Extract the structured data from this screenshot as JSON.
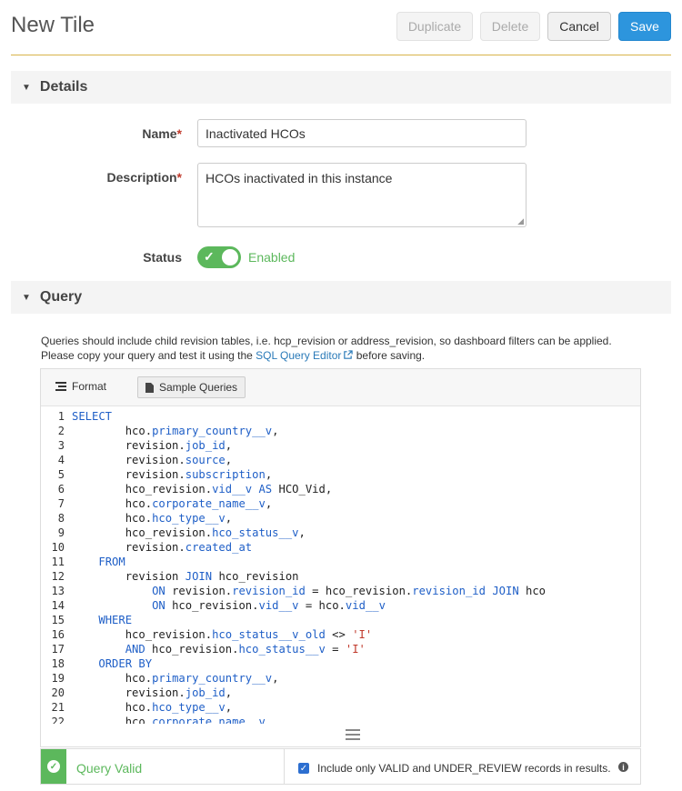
{
  "header": {
    "title": "New Tile",
    "duplicate_label": "Duplicate",
    "delete_label": "Delete",
    "cancel_label": "Cancel",
    "save_label": "Save"
  },
  "details": {
    "section_title": "Details",
    "name_label": "Name",
    "name_value": "Inactivated HCOs",
    "description_label": "Description",
    "description_value": "HCOs inactivated in this instance",
    "status_label": "Status",
    "status_value": "Enabled",
    "required_marker": "*"
  },
  "query": {
    "section_title": "Query",
    "help_line1": "Queries should include child revision tables, i.e. hcp_revision or address_revision, so dashboard filters can be applied.",
    "help_line2_pre": "Please copy your query and test it using the ",
    "help_link": "SQL Query Editor",
    "help_line2_post": " before saving.",
    "format_label": "Format",
    "sample_queries_label": "Sample Queries",
    "valid_label": "Query Valid",
    "include_label": "Include only VALID and UNDER_REVIEW records in results.",
    "include_checked": true
  },
  "icons": {
    "caret": "caret-down-icon",
    "format": "list-icon",
    "sample": "document-icon",
    "external": "external-link-icon",
    "valid": "check-circle-icon",
    "info": "info-icon",
    "resize": "resize-handle-icon"
  },
  "colors": {
    "accent": "#2d95dd",
    "valid": "#5cb85c",
    "keyword": "#1f5fc7",
    "string": "#c0392b",
    "divider": "#d8b44a"
  },
  "code_lines": [
    [
      [
        "kw",
        "SELECT"
      ]
    ],
    [
      [
        "txt",
        "        hco."
      ],
      [
        "fn",
        "primary_country__v"
      ],
      [
        "txt",
        ","
      ]
    ],
    [
      [
        "txt",
        "        revision."
      ],
      [
        "fn",
        "job_id"
      ],
      [
        "txt",
        ","
      ]
    ],
    [
      [
        "txt",
        "        revision."
      ],
      [
        "fn",
        "source"
      ],
      [
        "txt",
        ","
      ]
    ],
    [
      [
        "txt",
        "        revision."
      ],
      [
        "fn",
        "subscription"
      ],
      [
        "txt",
        ","
      ]
    ],
    [
      [
        "txt",
        "        hco_revision."
      ],
      [
        "fn",
        "vid__v"
      ],
      [
        "txt",
        " "
      ],
      [
        "kw",
        "AS"
      ],
      [
        "txt",
        " HCO_Vid,"
      ]
    ],
    [
      [
        "txt",
        "        hco."
      ],
      [
        "fn",
        "corporate_name__v"
      ],
      [
        "txt",
        ","
      ]
    ],
    [
      [
        "txt",
        "        hco."
      ],
      [
        "fn",
        "hco_type__v"
      ],
      [
        "txt",
        ","
      ]
    ],
    [
      [
        "txt",
        "        hco_revision."
      ],
      [
        "fn",
        "hco_status__v"
      ],
      [
        "txt",
        ","
      ]
    ],
    [
      [
        "txt",
        "        revision."
      ],
      [
        "fn",
        "created_at"
      ]
    ],
    [
      [
        "txt",
        "    "
      ],
      [
        "kw",
        "FROM"
      ]
    ],
    [
      [
        "txt",
        "        revision "
      ],
      [
        "kw",
        "JOIN"
      ],
      [
        "txt",
        " hco_revision"
      ]
    ],
    [
      [
        "txt",
        "            "
      ],
      [
        "kw",
        "ON"
      ],
      [
        "txt",
        " revision."
      ],
      [
        "fn",
        "revision_id"
      ],
      [
        "txt",
        " = hco_revision."
      ],
      [
        "fn",
        "revision_id"
      ],
      [
        "txt",
        " "
      ],
      [
        "kw",
        "JOIN"
      ],
      [
        "txt",
        " hco"
      ]
    ],
    [
      [
        "txt",
        "            "
      ],
      [
        "kw",
        "ON"
      ],
      [
        "txt",
        " hco_revision."
      ],
      [
        "fn",
        "vid__v"
      ],
      [
        "txt",
        " = hco."
      ],
      [
        "fn",
        "vid__v"
      ]
    ],
    [
      [
        "txt",
        "    "
      ],
      [
        "kw",
        "WHERE"
      ]
    ],
    [
      [
        "txt",
        "        hco_revision."
      ],
      [
        "fn",
        "hco_status__v_old"
      ],
      [
        "txt",
        " <> "
      ],
      [
        "str",
        "'I'"
      ]
    ],
    [
      [
        "txt",
        "        "
      ],
      [
        "kw",
        "AND"
      ],
      [
        "txt",
        " hco_revision."
      ],
      [
        "fn",
        "hco_status__v"
      ],
      [
        "txt",
        " = "
      ],
      [
        "str",
        "'I'"
      ]
    ],
    [
      [
        "txt",
        "    "
      ],
      [
        "kw",
        "ORDER BY"
      ]
    ],
    [
      [
        "txt",
        "        hco."
      ],
      [
        "fn",
        "primary_country__v"
      ],
      [
        "txt",
        ","
      ]
    ],
    [
      [
        "txt",
        "        revision."
      ],
      [
        "fn",
        "job_id"
      ],
      [
        "txt",
        ","
      ]
    ],
    [
      [
        "txt",
        "        hco."
      ],
      [
        "fn",
        "hco_type__v"
      ],
      [
        "txt",
        ","
      ]
    ],
    [
      [
        "txt",
        "        hco."
      ],
      [
        "fn",
        "corporate_name__v"
      ]
    ]
  ]
}
